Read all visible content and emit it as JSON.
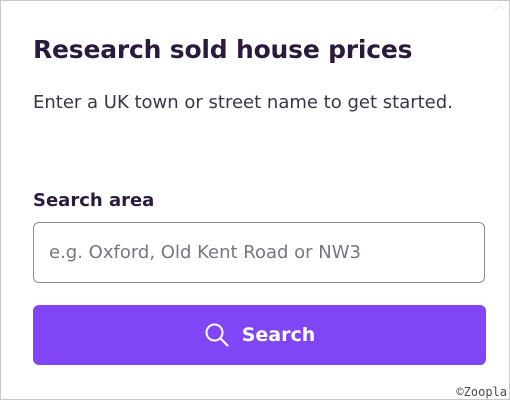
{
  "card": {
    "title": "Research sold house prices",
    "subtitle": "Enter a UK town or street name to get started."
  },
  "search": {
    "label": "Search area",
    "placeholder": "e.g. Oxford, Old Kent Road or NW3",
    "value": "",
    "button_label": "Search",
    "button_icon": "search-icon"
  },
  "footer": {
    "copyright": "©Zoopla"
  },
  "colors": {
    "accent": "#8046f5",
    "title_text": "#2a1b3d",
    "body_text": "#3c3347",
    "input_border": "#8f8a96"
  }
}
